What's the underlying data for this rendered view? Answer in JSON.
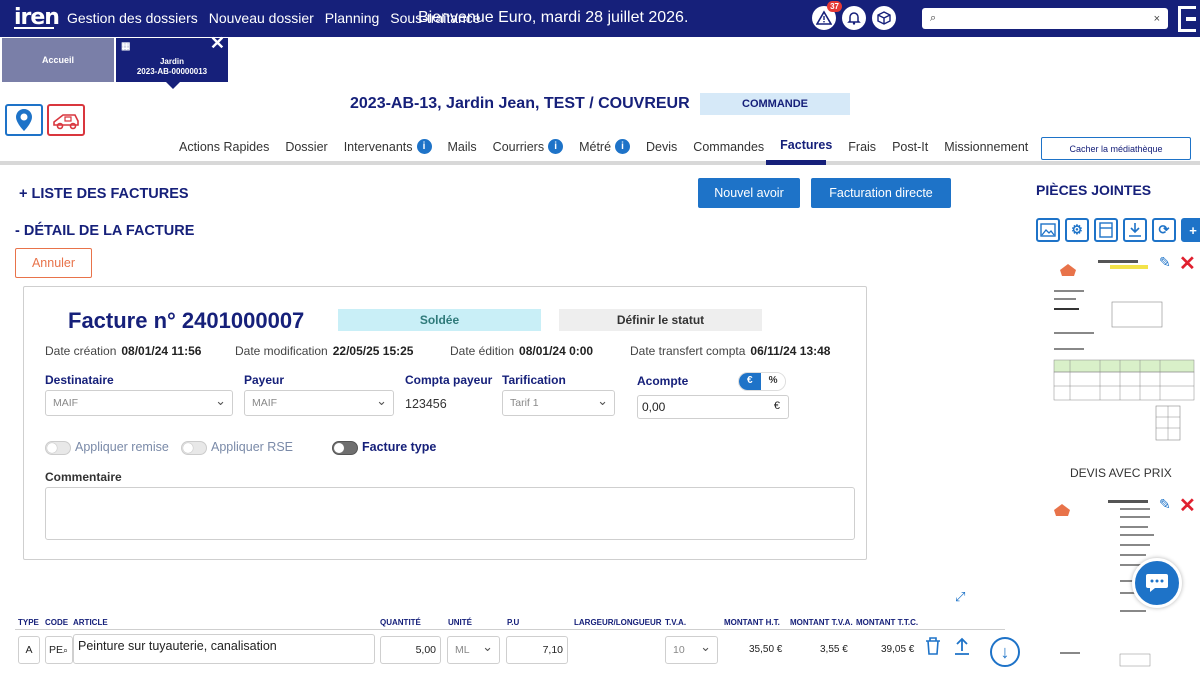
{
  "topbar": {
    "logo": "iren",
    "nav": [
      "Gestion des dossiers",
      "Nouveau dossier",
      "Planning",
      "Sous-traitance"
    ],
    "welcome": "Bienvenue Euro, mardi 28 juillet 2026.",
    "alert_count": "37",
    "search_placeholder": "",
    "search_clear": "×"
  },
  "tabs": {
    "home": "Accueil",
    "active_line1": "Jardin",
    "active_line2": "2023-AB-00000013",
    "close": "✕"
  },
  "dossier": {
    "title": "2023-AB-13, Jardin Jean, TEST / COUVREUR",
    "status": "COMMANDE"
  },
  "subtabs": [
    {
      "label": "Actions Rapides",
      "info": false
    },
    {
      "label": "Dossier",
      "info": false
    },
    {
      "label": "Intervenants",
      "info": true
    },
    {
      "label": "Mails",
      "info": false
    },
    {
      "label": "Courriers",
      "info": true
    },
    {
      "label": "Métré",
      "info": true
    },
    {
      "label": "Devis",
      "info": false
    },
    {
      "label": "Commandes",
      "info": false
    },
    {
      "label": "Factures",
      "info": false,
      "active": true
    },
    {
      "label": "Frais",
      "info": false
    },
    {
      "label": "Post-It",
      "info": false
    },
    {
      "label": "Missionnement",
      "info": false
    }
  ],
  "cacher_label": "Cacher la médiathèque",
  "main": {
    "list_header": "+ LISTE DES FACTURES",
    "detail_header": "- DÉTAIL DE LA FACTURE",
    "nouvel_avoir": "Nouvel avoir",
    "facturation_directe": "Facturation directe",
    "annuler": "Annuler"
  },
  "facture": {
    "title": "Facture n° 2401000007",
    "status": "Soldée",
    "definir": "Définir le statut",
    "date_creation_label": "Date création",
    "date_creation": "08/01/24 11:56",
    "date_modification_label": "Date modification",
    "date_modification": "22/05/25 15:25",
    "date_edition_label": "Date édition",
    "date_edition": "08/01/24 0:00",
    "date_transfert_label": "Date transfert compta",
    "date_transfert": "06/11/24 13:48",
    "destinataire_label": "Destinataire",
    "destinataire": "MAIF",
    "payeur_label": "Payeur",
    "payeur": "MAIF",
    "compta_payeur_label": "Compta payeur",
    "compta_payeur": "123456",
    "tarification_label": "Tarification",
    "tarification": "Tarif 1",
    "acompte_label": "Acompte",
    "acompte_euro": "€",
    "acompte_pct": "%",
    "acompte_value": "0,00",
    "acompte_unit": "€",
    "remise_label": "Appliquer remise",
    "rse_label": "Appliquer RSE",
    "facture_type_label": "Facture type",
    "commentaire_label": "Commentaire"
  },
  "table": {
    "headers": [
      "TYPE",
      "CODE",
      "ARTICLE",
      "QUANTITÉ",
      "UNITÉ",
      "P.U",
      "LARGEUR/LONGUEUR",
      "T.V.A.",
      "MONTANT H.T.",
      "MONTANT T.V.A.",
      "MONTANT T.T.C."
    ],
    "row": {
      "type": "A",
      "code": "PE",
      "article": "Peinture sur tuyauterie, canalisation",
      "quantite": "5,00",
      "unite": "ML",
      "pu": "7,10",
      "tva": "10",
      "montant_ht": "35,50 €",
      "montant_tva": "3,55 €",
      "montant_ttc": "39,05 €"
    }
  },
  "pieces_jointes": {
    "title": "PIÈCES JOINTES",
    "doc1_label": "DEVIS AVEC PRIX"
  },
  "colors": {
    "navy": "#16207a",
    "blue": "#1e73c8",
    "red": "#e0202f",
    "soldee_bg": "#c9eff7"
  }
}
